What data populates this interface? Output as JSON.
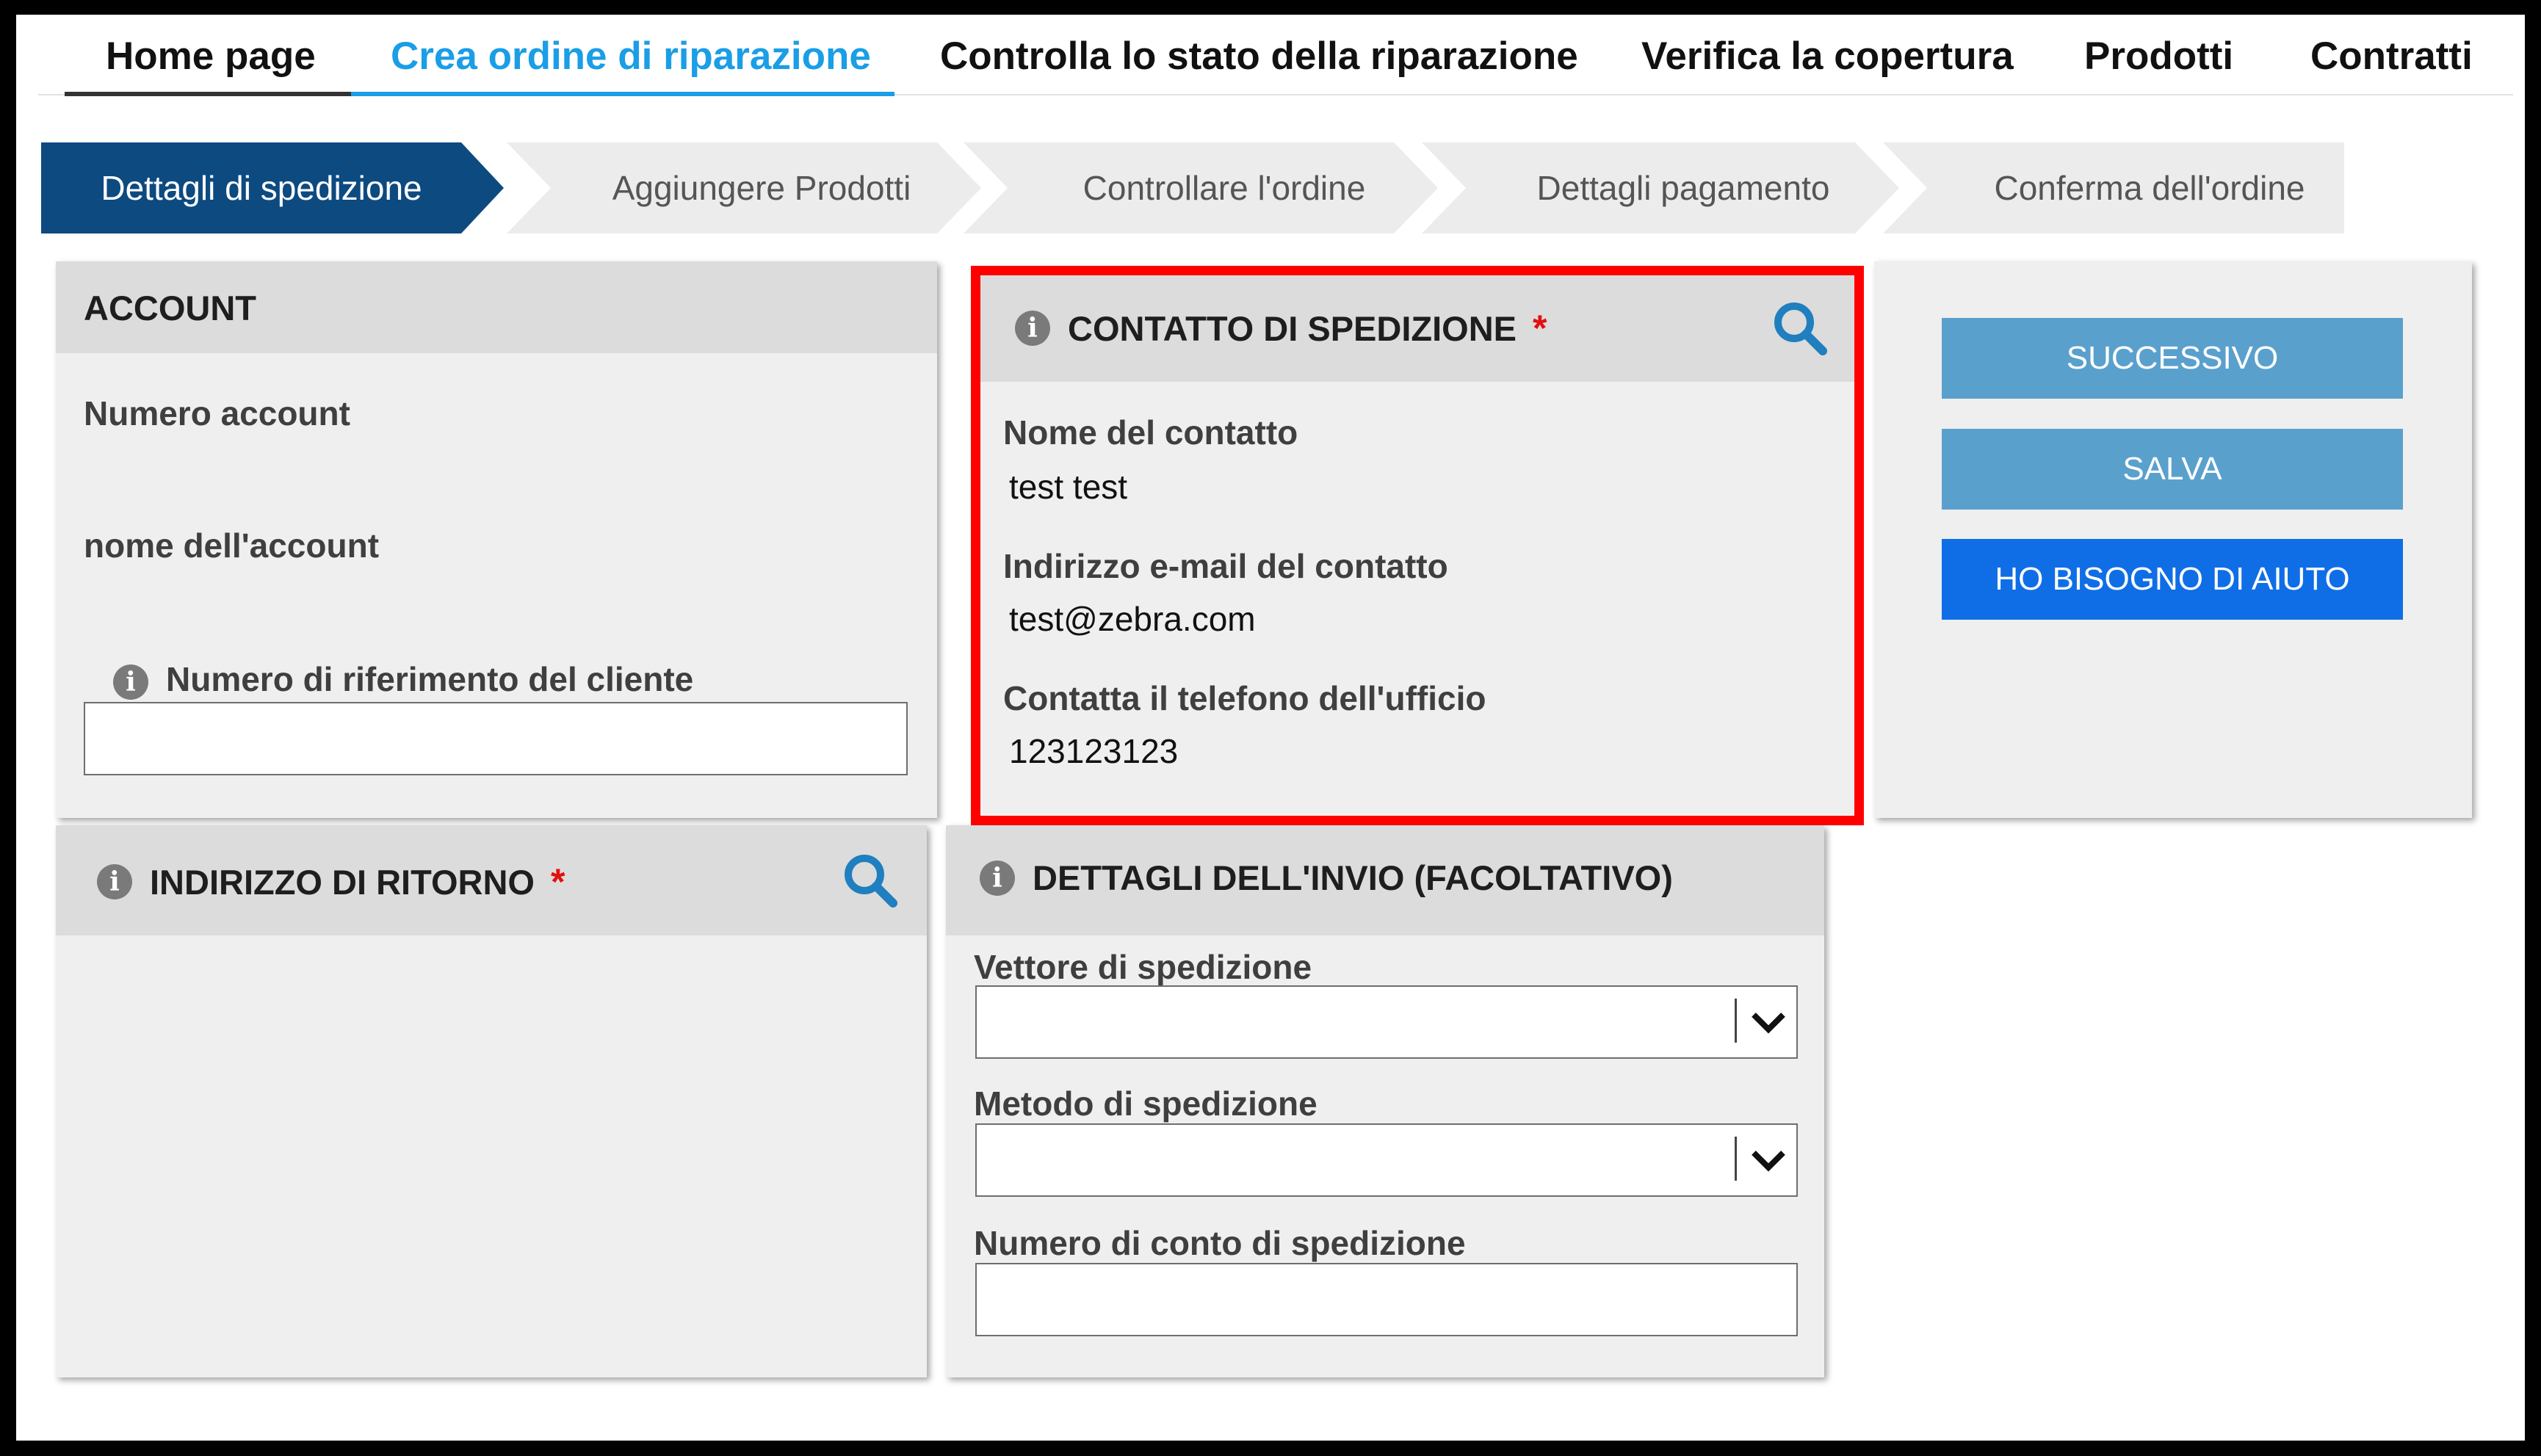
{
  "nav": {
    "items": [
      {
        "label": "Home page"
      },
      {
        "label": "Crea ordine di riparazione"
      },
      {
        "label": "Controlla lo stato della riparazione"
      },
      {
        "label": "Verifica la copertura"
      },
      {
        "label": "Prodotti"
      },
      {
        "label": "Contratti"
      }
    ],
    "active_index": 1
  },
  "steps": [
    {
      "label": "Dettagli di spedizione"
    },
    {
      "label": "Aggiungere Prodotti"
    },
    {
      "label": "Controllare l'ordine"
    },
    {
      "label": "Dettagli pagamento"
    },
    {
      "label": "Conferma dell'ordine"
    }
  ],
  "account": {
    "title": "ACCOUNT",
    "account_number_label": "Numero account",
    "account_name_label": "nome dell'account",
    "customer_ref_label": "Numero di riferimento del cliente",
    "customer_ref_value": ""
  },
  "shipping_contact": {
    "title": "CONTATTO DI SPEDIZIONE",
    "required_mark": "*",
    "contact_name_label": "Nome del contatto",
    "contact_name_value": "test test",
    "email_label": "Indirizzo e-mail del contatto",
    "email_value": "test@zebra.com",
    "phone_label": "Contatta il telefono dell'ufficio",
    "phone_value": "123123123"
  },
  "actions": {
    "next_label": "SUCCESSIVO",
    "save_label": "SALVA",
    "help_label": "HO BISOGNO DI AIUTO"
  },
  "return_address": {
    "title": "INDIRIZZO DI RITORNO",
    "required_mark": "*"
  },
  "shipment_details": {
    "title": "DETTAGLI DELL'INVIO (FACOLTATIVO)",
    "carrier_label": "Vettore di spedizione",
    "carrier_value": "",
    "method_label": "Metodo di spedizione",
    "method_value": "",
    "account_number_label": "Numero di conto di spedizione",
    "account_number_value": ""
  },
  "colors": {
    "accent": "#1a9ee6",
    "step_active": "#0d4a80",
    "button_light": "#5aa0cd",
    "button_primary": "#0f6ee6",
    "highlight": "#ff0000",
    "required": "#e21010"
  },
  "icons": [
    "info-icon",
    "search-icon",
    "chevron-down-icon"
  ]
}
